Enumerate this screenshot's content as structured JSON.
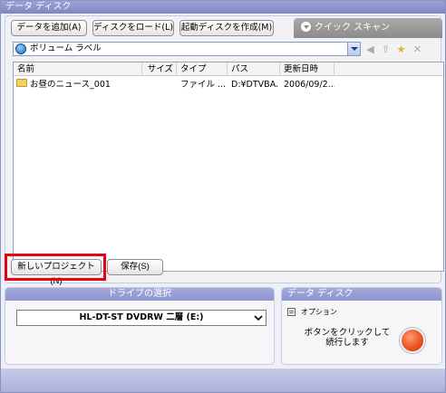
{
  "window": {
    "title": "データ ディスク"
  },
  "toolbar": {
    "add_data": "データを追加(A)",
    "load_disc": "ディスクをロード(L)",
    "create_boot": "起動ディスクを作成(M)",
    "quick_scan": "クイック スキャン"
  },
  "pathbar": {
    "value": "ボリューム ラベル"
  },
  "columns": [
    "名前",
    "サイズ",
    "タイプ",
    "パス",
    "更新日時"
  ],
  "files": [
    {
      "name": "お昼のニュース_001",
      "size": "",
      "type": "ファイル ...",
      "path": "D:¥DTVBA...",
      "modified": "2006/09/2..."
    }
  ],
  "bottom_buttons": {
    "new_project": "新しいプロジェクト(N)",
    "save": "保存(S)"
  },
  "drive_panel": {
    "title": "ドライブの選択",
    "selected_drive": "HL-DT-ST DVDRW 二層 (E:)"
  },
  "data_panel": {
    "title": "データ ディスク",
    "option_label": "オプション",
    "message": "ボタンをクリックして続行します"
  },
  "colors": {
    "highlight": "#e60012",
    "accent": "#8d94cc",
    "go_button": "#e8501f"
  }
}
